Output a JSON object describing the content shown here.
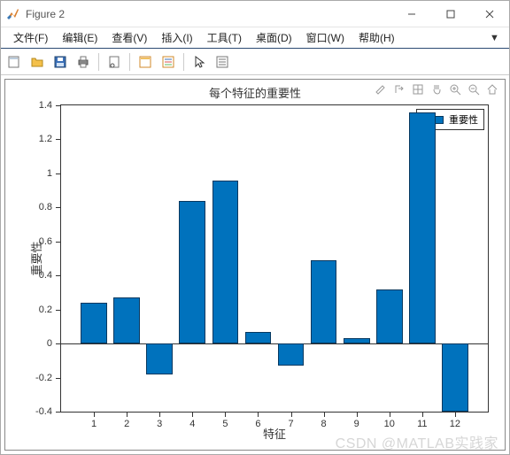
{
  "window": {
    "title": "Figure 2",
    "controls": {
      "min": "minimize",
      "max": "maximize",
      "close": "close"
    }
  },
  "menubar": {
    "items": [
      "文件(F)",
      "编辑(E)",
      "查看(V)",
      "插入(I)",
      "工具(T)",
      "桌面(D)",
      "窗口(W)",
      "帮助(H)"
    ]
  },
  "toolbar": {
    "items": [
      "new-figure",
      "open-file",
      "save",
      "print",
      "sep",
      "page-setup",
      "sep",
      "link-axes",
      "insert-legend",
      "sep",
      "pointer",
      "data-cursor"
    ]
  },
  "plot_toolbar": {
    "items": [
      "brush-icon",
      "export-icon",
      "cursor-icon",
      "pan-icon",
      "zoom-in-icon",
      "zoom-out-icon",
      "home-icon"
    ]
  },
  "chart_data": {
    "type": "bar",
    "title": "每个特征的重要性",
    "xlabel": "特征",
    "ylabel": "重要性",
    "xlim": [
      0,
      13
    ],
    "ylim": [
      -0.4,
      1.4
    ],
    "x_ticks": [
      1,
      2,
      3,
      4,
      5,
      6,
      7,
      8,
      9,
      10,
      11,
      12
    ],
    "y_ticks": [
      -0.4,
      -0.2,
      0,
      0.2,
      0.4,
      0.6,
      0.8,
      1,
      1.2,
      1.4
    ],
    "categories": [
      "1",
      "2",
      "3",
      "4",
      "5",
      "6",
      "7",
      "8",
      "9",
      "10",
      "11",
      "12"
    ],
    "values": [
      0.24,
      0.27,
      -0.18,
      0.84,
      0.96,
      0.07,
      -0.13,
      0.49,
      0.03,
      0.32,
      1.36,
      -0.4
    ],
    "legend": {
      "label": "重要性"
    },
    "bar_color": "#0072bd"
  },
  "watermark": "CSDN @MATLAB实践家"
}
